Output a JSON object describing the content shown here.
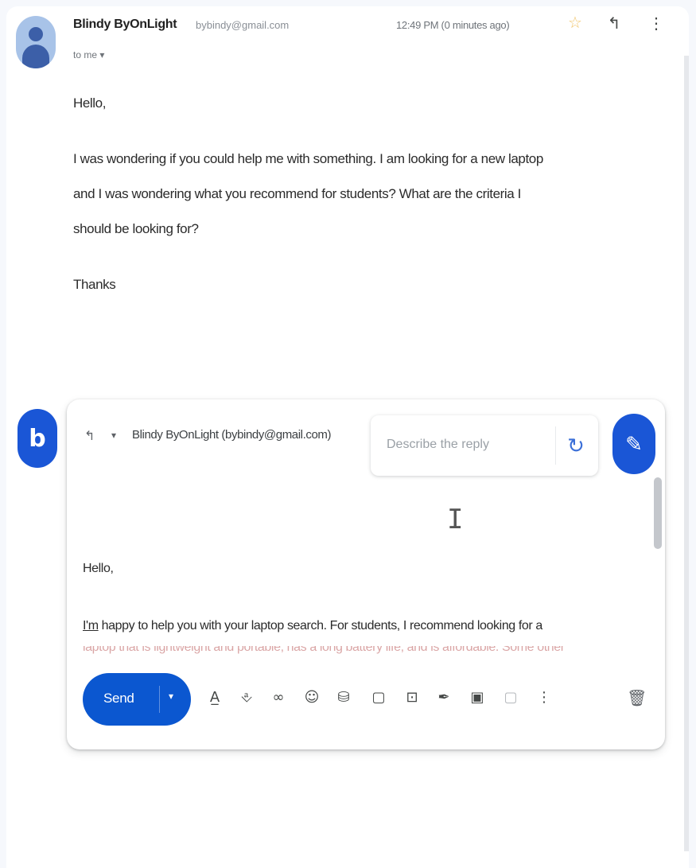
{
  "sender": {
    "name": "Blindy ByOnLight",
    "email": "bybindy@gmail.com",
    "to_label": "to me",
    "timestamp": "12:49 PM (0 minutes ago)"
  },
  "message": {
    "greeting": "Hello,",
    "lines": [
      "I was wondering if you could help me with something. I am looking for a new laptop",
      "and I was wondering what you recommend for students? What are the criteria I",
      "should be looking for?"
    ],
    "signoff": "Thanks"
  },
  "reply": {
    "avatar_letter": "b",
    "recipient": "Blindy ByOnLight (bybindy@gmail.com)",
    "describe_placeholder": "Describe the reply",
    "draft_greeting": "Hello,",
    "draft_line_im": "I'm",
    "draft_line_rest": " happy to help you with your laptop search. For students, I recommend looking for a",
    "draft_line_cut": "laptop that is lightweight and portable, has a long battery life, and is affordable. Some other",
    "send_label": "Send"
  },
  "icons": {
    "star": "star-icon",
    "reply": "reply-icon",
    "more": "more-vert-icon",
    "refresh": "refresh-icon",
    "pen": "pen-icon",
    "trash": "trash-icon"
  },
  "colors": {
    "accent": "#0b57d0",
    "bing": "#1a56d6",
    "star": "#f1c56a"
  }
}
